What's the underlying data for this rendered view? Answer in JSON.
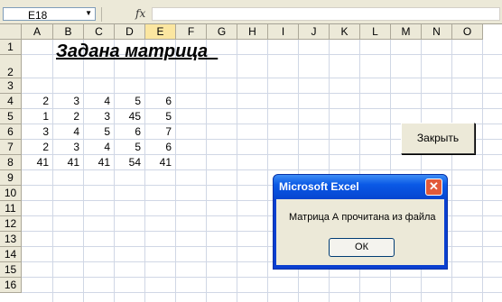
{
  "formula_bar": {
    "name_box": "E18",
    "fx_label": "fx",
    "formula": ""
  },
  "columns": [
    "A",
    "B",
    "C",
    "D",
    "E",
    "F",
    "G",
    "H",
    "I",
    "J",
    "K",
    "L",
    "M",
    "N",
    "O"
  ],
  "selected_column": "E",
  "rows": [
    "1",
    "2",
    "3",
    "4",
    "5",
    "6",
    "7",
    "8",
    "9",
    "10",
    "11",
    "12",
    "13",
    "14",
    "15",
    "16"
  ],
  "sheet": {
    "title": "Задана матрица  ",
    "matrix": [
      [
        "2",
        "3",
        "4",
        "5",
        "6"
      ],
      [
        "1",
        "2",
        "3",
        "45",
        "5"
      ],
      [
        "3",
        "4",
        "5",
        "6",
        "7"
      ],
      [
        "2",
        "3",
        "4",
        "5",
        "6"
      ],
      [
        "41",
        "41",
        "41",
        "54",
        "41"
      ]
    ]
  },
  "close_button": {
    "label": "Закрыть"
  },
  "dialog": {
    "title": "Microsoft Excel",
    "message": "Матрица А прочитана из файла",
    "ok_label": "ОК",
    "close_glyph": "✕"
  }
}
